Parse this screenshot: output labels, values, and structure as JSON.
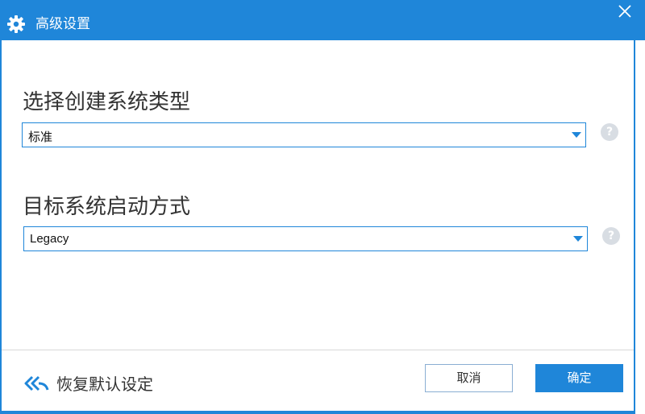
{
  "window": {
    "title": "高级设置",
    "icon": "gear-icon",
    "accent_color": "#1f86d9",
    "close_icon": "close-icon"
  },
  "sections": [
    {
      "label": "选择创建系统类型",
      "selected": "标准",
      "help": "?"
    },
    {
      "label": "目标系统启动方式",
      "selected": "Legacy",
      "help": "?"
    }
  ],
  "footer": {
    "restore_label": "恢复默认设定",
    "restore_icon": "double-back-arrow-icon",
    "cancel_label": "取消",
    "ok_label": "确定"
  }
}
